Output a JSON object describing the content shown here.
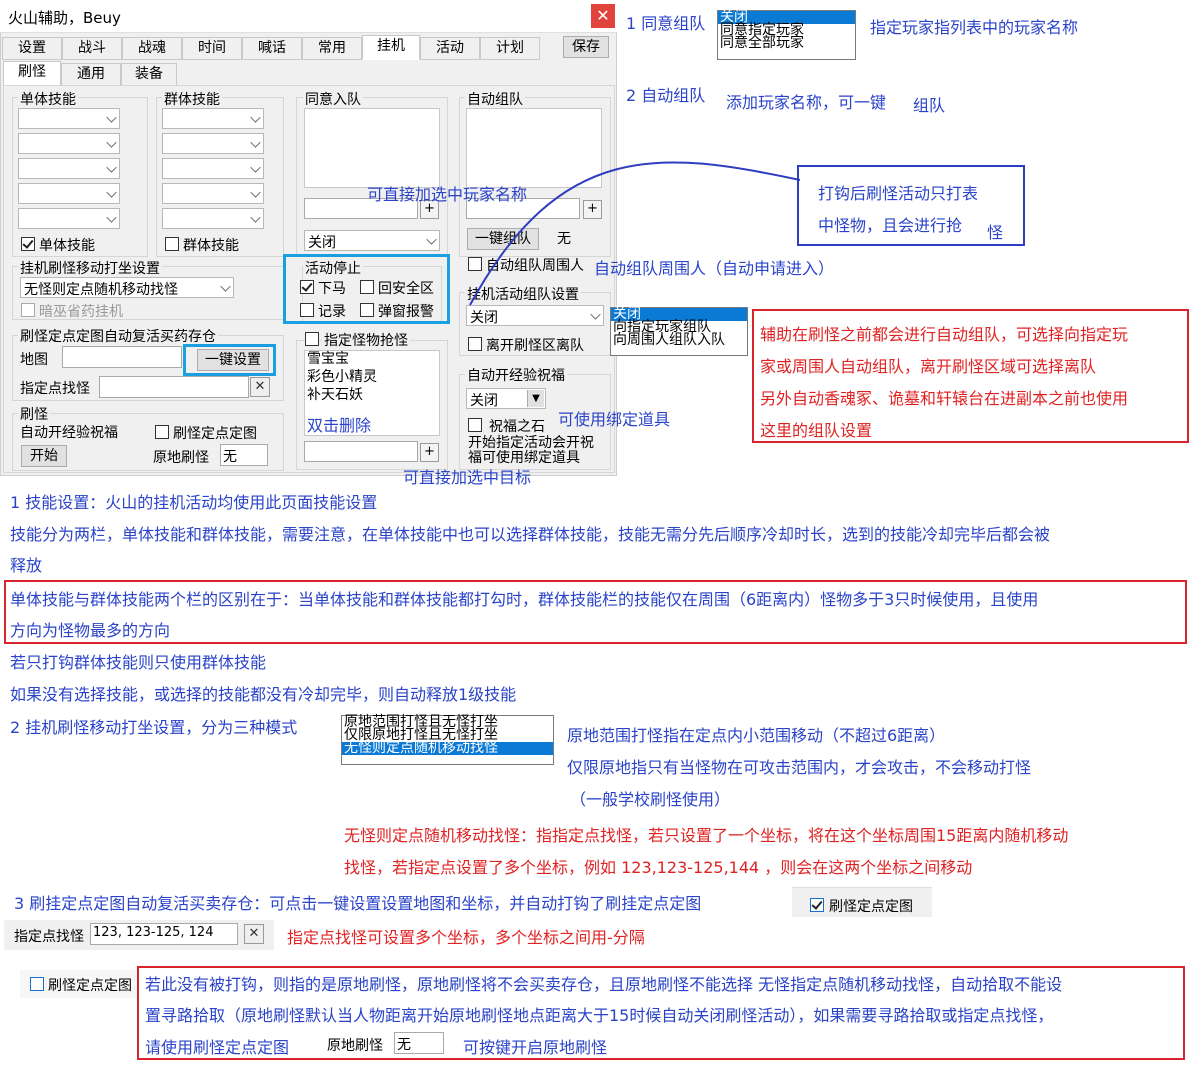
{
  "window": {
    "title": "火山辅助，Beuy",
    "close_glyph": "✕",
    "tabs": [
      "设置",
      "战斗",
      "战魂",
      "时间",
      "喊话",
      "常用",
      "挂机",
      "活动",
      "计划"
    ],
    "save_label": "保存",
    "subtabs": [
      "刷怪",
      "通用",
      "装备"
    ]
  },
  "skills": {
    "single_title": "单体技能",
    "group_title": "群体技能",
    "single_check": "单体技能",
    "group_check": "群体技能"
  },
  "move": {
    "title": "挂机刷怪移动打坐设置",
    "value": "无怪则定点随机移动找怪",
    "herb_check": "暗巫省药挂机"
  },
  "fixed": {
    "title": "刷怪定点定图自动复活买药存仓",
    "map_label": "地图",
    "setup_button": "一键设置",
    "point_label": "指定点找怪",
    "clear_glyph": "✕"
  },
  "refresh": {
    "title": "刷怪",
    "bless_label": "自动开经验祝福",
    "start_button": "开始",
    "fixed_check": "刷怪定点定图",
    "local_label": "原地刷怪",
    "local_value": "无"
  },
  "agree": {
    "title": "同意入队",
    "plus": "+",
    "combo_value": "关闭"
  },
  "auto_team": {
    "title": "自动组队",
    "plus": "+",
    "team_button": "一键组队",
    "team_value": "无",
    "nearby_check": "自动组队周围人"
  },
  "stop": {
    "title": "活动停止",
    "horse": "下马",
    "safe": "回安全区",
    "record": "记录",
    "popup": "弹窗报警"
  },
  "activity_team": {
    "title": "挂机活动组队设置",
    "value": "关闭",
    "leave_check": "离开刷怪区离队"
  },
  "monster": {
    "check": "指定怪物抢怪",
    "items": [
      "雪宝宝",
      "彩色小精灵",
      "补天石妖"
    ],
    "hint": "双击删除",
    "plus": "+"
  },
  "bless": {
    "title": "自动开经验祝福",
    "value": "关闭",
    "stone_check": "祝福之石",
    "note_line1": "开始指定活动会开祝",
    "note_line2": "福可使用绑定道具"
  },
  "ann": {
    "a1_label": "1 同意组队",
    "a1_options": [
      "关闭",
      "同意指定玩家",
      "同意全部玩家"
    ],
    "a1_desc": "指定玩家指列表中的玩家名称",
    "a2_label": "2 自动组队",
    "a2_desc_a": "添加玩家名称，可一键",
    "a2_desc_b": "组队",
    "add_player": "可直接加选中玩家名称",
    "kill_line1": "打钩后刷怪活动只打表",
    "kill_line2": "中怪物，且会进行抢",
    "kill_line3": "怪",
    "nearby_note": "自动组队周围人（自动申请进入）",
    "team_options": [
      "关闭",
      "向指定玩家组队",
      "向周围人组队入队"
    ],
    "team_red_lines": [
      "辅助在刷怪之前都会进行自动组队，可选择向指定玩",
      "家或周围人自动组队，离开刷怪区域可选择离队",
      "另外自动香魂冢、诡墓和轩辕台在进副本之前也使用",
      "这里的组队设置"
    ],
    "bind_note": "可使用绑定道具",
    "add_target": "可直接加选中目标",
    "s1": "1 技能设置：火山的挂机活动均使用此页面技能设置",
    "s1b": "技能分为两栏，单体技能和群体技能，需要注意，在单体技能中也可以选择群体技能，技能无需分先后顺序冷却时长，选到的技能冷却完毕后都会被",
    "s1c": "释放",
    "s1_red_a": "单体技能与群体技能两个栏的区别在于：当单体技能和群体技能都打勾时，群体技能栏的技能仅在周围（6距离内）怪物多于3只时候使用，且使用",
    "s1_red_b": "方向为怪物最多的方向",
    "s1d": "若只打钩群体技能则只使用群体技能",
    "s1e": "如果没有选择技能，或选择的技能都没有冷却完毕，则自动释放1级技能",
    "s2": "2 挂机刷怪移动打坐设置，分为三种模式",
    "s2_options": [
      "原地范围打怪且无怪打坐",
      "仅限原地打怪且无怪打坐",
      "无怪则定点随机移动找怪"
    ],
    "s2_a": "原地范围打怪指在定点内小范围移动（不超过6距离）",
    "s2_b": "仅限原地指只有当怪物在可攻击范围内，才会攻击，不会移动打怪",
    "s2_c": "（一般学校刷怪使用）",
    "s2_red_a": "无怪则定点随机移动找怪：指指定点找怪，若只设置了一个坐标，将在这个坐标周围15距离内随机移动",
    "s2_red_b": "找怪，若指定点设置了多个坐标，例如  123,123-125,144 ，则会在这两个坐标之间移动",
    "s3": "3 刷挂定点定图自动复活买卖存仓：可点击一键设置设置地图和坐标，并自动打钩了刷挂定点定图",
    "s3_check": "刷怪定点定图",
    "s3_point_label": "指定点找怪",
    "s3_point_value": "123, 123-125, 124",
    "s3_red": "指定点找怪可设置多个坐标，多个坐标之间用-分隔",
    "s4_check": "刷怪定点定图",
    "s4_red_a": "若此没有被打钩，则指的是原地刷怪，原地刷怪将不会买卖存仓，且原地刷怪不能选择 无怪指定点随机移动找怪，自动拾取不能设",
    "s4_red_b": "置寻路拾取（原地刷怪默认当人物距离开始原地刷怪地点距离大于15时候自动关闭刷怪活动），如果需要寻路拾取或指定点找怪，",
    "s4_red_c": "请使用刷怪定点定图",
    "s4_local_label": "原地刷怪",
    "s4_local_value": "无",
    "s4_note": "可按键开启原地刷怪"
  }
}
